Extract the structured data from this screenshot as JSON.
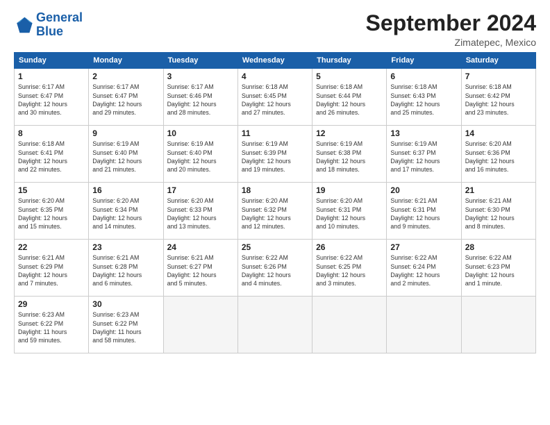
{
  "logo": {
    "line1": "General",
    "line2": "Blue"
  },
  "title": "September 2024",
  "location": "Zimatepec, Mexico",
  "days_header": [
    "Sunday",
    "Monday",
    "Tuesday",
    "Wednesday",
    "Thursday",
    "Friday",
    "Saturday"
  ],
  "weeks": [
    [
      {
        "day": "1",
        "info": "Sunrise: 6:17 AM\nSunset: 6:47 PM\nDaylight: 12 hours\nand 30 minutes."
      },
      {
        "day": "2",
        "info": "Sunrise: 6:17 AM\nSunset: 6:47 PM\nDaylight: 12 hours\nand 29 minutes."
      },
      {
        "day": "3",
        "info": "Sunrise: 6:17 AM\nSunset: 6:46 PM\nDaylight: 12 hours\nand 28 minutes."
      },
      {
        "day": "4",
        "info": "Sunrise: 6:18 AM\nSunset: 6:45 PM\nDaylight: 12 hours\nand 27 minutes."
      },
      {
        "day": "5",
        "info": "Sunrise: 6:18 AM\nSunset: 6:44 PM\nDaylight: 12 hours\nand 26 minutes."
      },
      {
        "day": "6",
        "info": "Sunrise: 6:18 AM\nSunset: 6:43 PM\nDaylight: 12 hours\nand 25 minutes."
      },
      {
        "day": "7",
        "info": "Sunrise: 6:18 AM\nSunset: 6:42 PM\nDaylight: 12 hours\nand 23 minutes."
      }
    ],
    [
      {
        "day": "8",
        "info": "Sunrise: 6:18 AM\nSunset: 6:41 PM\nDaylight: 12 hours\nand 22 minutes."
      },
      {
        "day": "9",
        "info": "Sunrise: 6:19 AM\nSunset: 6:40 PM\nDaylight: 12 hours\nand 21 minutes."
      },
      {
        "day": "10",
        "info": "Sunrise: 6:19 AM\nSunset: 6:40 PM\nDaylight: 12 hours\nand 20 minutes."
      },
      {
        "day": "11",
        "info": "Sunrise: 6:19 AM\nSunset: 6:39 PM\nDaylight: 12 hours\nand 19 minutes."
      },
      {
        "day": "12",
        "info": "Sunrise: 6:19 AM\nSunset: 6:38 PM\nDaylight: 12 hours\nand 18 minutes."
      },
      {
        "day": "13",
        "info": "Sunrise: 6:19 AM\nSunset: 6:37 PM\nDaylight: 12 hours\nand 17 minutes."
      },
      {
        "day": "14",
        "info": "Sunrise: 6:20 AM\nSunset: 6:36 PM\nDaylight: 12 hours\nand 16 minutes."
      }
    ],
    [
      {
        "day": "15",
        "info": "Sunrise: 6:20 AM\nSunset: 6:35 PM\nDaylight: 12 hours\nand 15 minutes."
      },
      {
        "day": "16",
        "info": "Sunrise: 6:20 AM\nSunset: 6:34 PM\nDaylight: 12 hours\nand 14 minutes."
      },
      {
        "day": "17",
        "info": "Sunrise: 6:20 AM\nSunset: 6:33 PM\nDaylight: 12 hours\nand 13 minutes."
      },
      {
        "day": "18",
        "info": "Sunrise: 6:20 AM\nSunset: 6:32 PM\nDaylight: 12 hours\nand 12 minutes."
      },
      {
        "day": "19",
        "info": "Sunrise: 6:20 AM\nSunset: 6:31 PM\nDaylight: 12 hours\nand 10 minutes."
      },
      {
        "day": "20",
        "info": "Sunrise: 6:21 AM\nSunset: 6:31 PM\nDaylight: 12 hours\nand 9 minutes."
      },
      {
        "day": "21",
        "info": "Sunrise: 6:21 AM\nSunset: 6:30 PM\nDaylight: 12 hours\nand 8 minutes."
      }
    ],
    [
      {
        "day": "22",
        "info": "Sunrise: 6:21 AM\nSunset: 6:29 PM\nDaylight: 12 hours\nand 7 minutes."
      },
      {
        "day": "23",
        "info": "Sunrise: 6:21 AM\nSunset: 6:28 PM\nDaylight: 12 hours\nand 6 minutes."
      },
      {
        "day": "24",
        "info": "Sunrise: 6:21 AM\nSunset: 6:27 PM\nDaylight: 12 hours\nand 5 minutes."
      },
      {
        "day": "25",
        "info": "Sunrise: 6:22 AM\nSunset: 6:26 PM\nDaylight: 12 hours\nand 4 minutes."
      },
      {
        "day": "26",
        "info": "Sunrise: 6:22 AM\nSunset: 6:25 PM\nDaylight: 12 hours\nand 3 minutes."
      },
      {
        "day": "27",
        "info": "Sunrise: 6:22 AM\nSunset: 6:24 PM\nDaylight: 12 hours\nand 2 minutes."
      },
      {
        "day": "28",
        "info": "Sunrise: 6:22 AM\nSunset: 6:23 PM\nDaylight: 12 hours\nand 1 minute."
      }
    ],
    [
      {
        "day": "29",
        "info": "Sunrise: 6:23 AM\nSunset: 6:22 PM\nDaylight: 11 hours\nand 59 minutes."
      },
      {
        "day": "30",
        "info": "Sunrise: 6:23 AM\nSunset: 6:22 PM\nDaylight: 11 hours\nand 58 minutes."
      },
      {
        "day": "",
        "info": ""
      },
      {
        "day": "",
        "info": ""
      },
      {
        "day": "",
        "info": ""
      },
      {
        "day": "",
        "info": ""
      },
      {
        "day": "",
        "info": ""
      }
    ]
  ]
}
